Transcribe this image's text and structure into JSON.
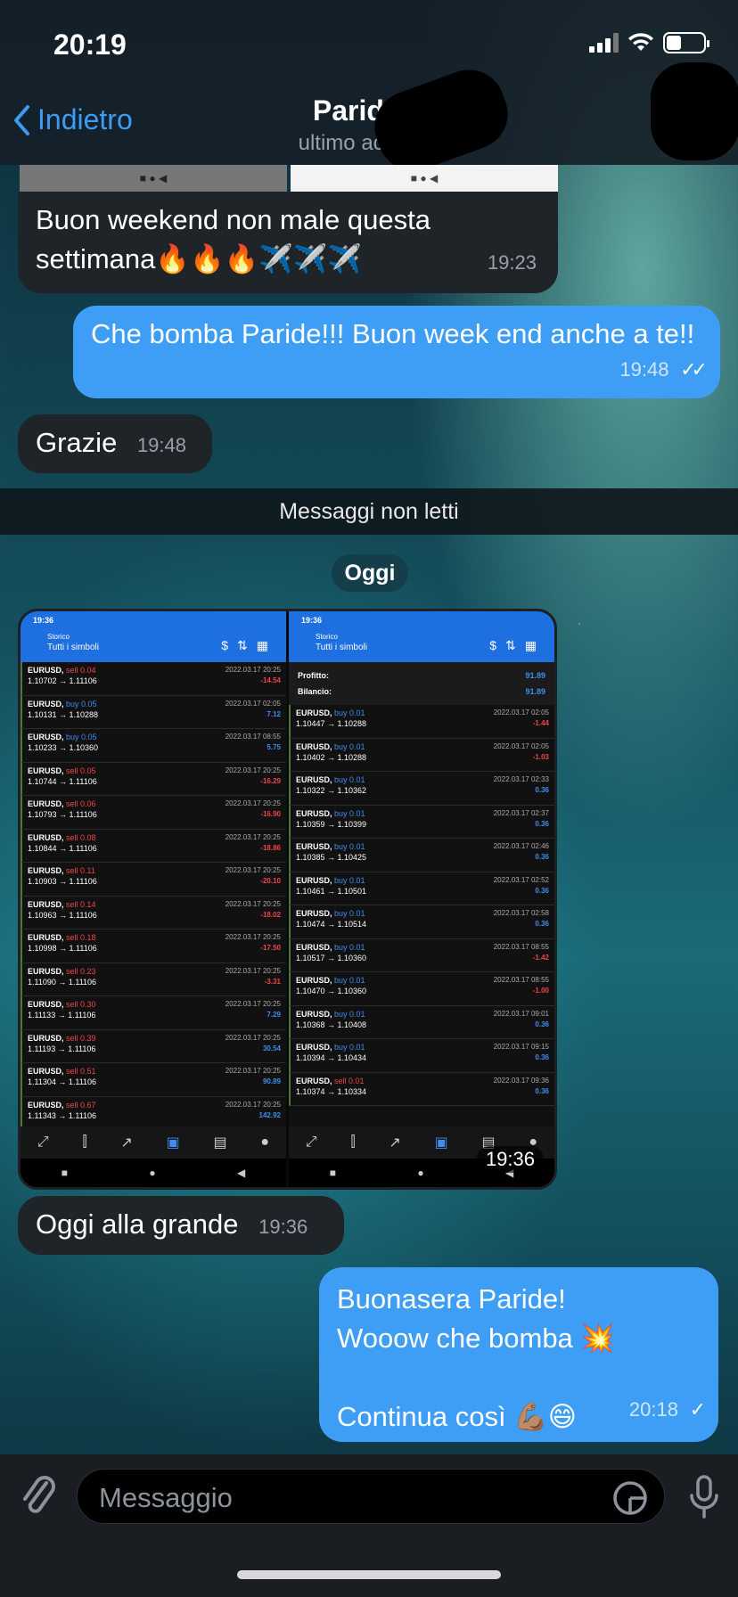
{
  "status_bar": {
    "time": "20:19"
  },
  "header": {
    "back_label": "Indietro",
    "contact_name": "Paride T",
    "contact_status": "ultimo accesso"
  },
  "messages": [
    {
      "dir": "in",
      "text": "Buon weekend non male questa settimana🔥🔥🔥✈️✈️✈️",
      "time": "19:23"
    },
    {
      "dir": "out",
      "text": "Che bomba Paride!!! Buon week end anche a te!!",
      "time": "19:48"
    },
    {
      "dir": "in",
      "text": "Grazie",
      "time": "19:48"
    },
    {
      "dir": "in",
      "text": "Oggi alla grande",
      "time": "19:36"
    },
    {
      "dir": "out",
      "line1": "Buonasera Paride!",
      "line2": "Wooow che bomba 💥",
      "line3": "Continua così 💪🏽😄",
      "time": "20:18"
    }
  ],
  "unread_label": "Messaggi non letti",
  "date_label": "Oggi",
  "screenshot": {
    "time": "19:36",
    "phone_time": "19:36",
    "app_title": "Storico",
    "app_subtitle": "Tutti i simboli",
    "summary": {
      "profit_label": "Profitto:",
      "profit": "91.89",
      "balance_label": "Bilancio:",
      "balance": "91.89"
    },
    "left_trades": [
      {
        "sym": "EURUSD,",
        "side": "sell 0.04",
        "type": "sell",
        "range": "1.10702 → 1.11106",
        "date": "2022.03.17 20:25",
        "pl": "-14.54",
        "pl_type": "neg"
      },
      {
        "sym": "EURUSD,",
        "side": "buy 0.05",
        "type": "buy",
        "range": "1.10131 → 1.10288",
        "date": "2022.03.17 02:05",
        "pl": "7.12",
        "pl_type": "pos"
      },
      {
        "sym": "EURUSD,",
        "side": "buy 0.05",
        "type": "buy",
        "range": "1.10233 → 1.10360",
        "date": "2022.03.17 08:55",
        "pl": "5.75",
        "pl_type": "pos"
      },
      {
        "sym": "EURUSD,",
        "side": "sell 0.05",
        "type": "sell",
        "range": "1.10744 → 1.11106",
        "date": "2022.03.17 20:25",
        "pl": "-16.29",
        "pl_type": "neg"
      },
      {
        "sym": "EURUSD,",
        "side": "sell 0.06",
        "type": "sell",
        "range": "1.10793 → 1.11106",
        "date": "2022.03.17 20:25",
        "pl": "-16.90",
        "pl_type": "neg"
      },
      {
        "sym": "EURUSD,",
        "side": "sell 0.08",
        "type": "sell",
        "range": "1.10844 → 1.11106",
        "date": "2022.03.17 20:25",
        "pl": "-18.86",
        "pl_type": "neg"
      },
      {
        "sym": "EURUSD,",
        "side": "sell 0.11",
        "type": "sell",
        "range": "1.10903 → 1.11106",
        "date": "2022.03.17 20:25",
        "pl": "-20.10",
        "pl_type": "neg"
      },
      {
        "sym": "EURUSD,",
        "side": "sell 0.14",
        "type": "sell",
        "range": "1.10963 → 1.11106",
        "date": "2022.03.17 20:25",
        "pl": "-18.02",
        "pl_type": "neg"
      },
      {
        "sym": "EURUSD,",
        "side": "sell 0.18",
        "type": "sell",
        "range": "1.10998 → 1.11106",
        "date": "2022.03.17 20:25",
        "pl": "-17.50",
        "pl_type": "neg"
      },
      {
        "sym": "EURUSD,",
        "side": "sell 0.23",
        "type": "sell",
        "range": "1.11090 → 1.11106",
        "date": "2022.03.17 20:25",
        "pl": "-3.31",
        "pl_type": "neg"
      },
      {
        "sym": "EURUSD,",
        "side": "sell 0.30",
        "type": "sell",
        "range": "1.11133 → 1.11106",
        "date": "2022.03.17 20:25",
        "pl": "7.29",
        "pl_type": "pos"
      },
      {
        "sym": "EURUSD,",
        "side": "sell 0.39",
        "type": "sell",
        "range": "1.11193 → 1.11106",
        "date": "2022.03.17 20:25",
        "pl": "30.54",
        "pl_type": "pos"
      },
      {
        "sym": "EURUSD,",
        "side": "sell 0.51",
        "type": "sell",
        "range": "1.11304 → 1.11106",
        "date": "2022.03.17 20:25",
        "pl": "90.89",
        "pl_type": "pos"
      },
      {
        "sym": "EURUSD,",
        "side": "sell 0.67",
        "type": "sell",
        "range": "1.11343 → 1.11106",
        "date": "2022.03.17 20:25",
        "pl": "142.92",
        "pl_type": "pos"
      }
    ],
    "right_trades": [
      {
        "sym": "EURUSD,",
        "side": "buy 0.01",
        "type": "buy",
        "range": "1.10447 → 1.10288",
        "date": "2022.03.17 02:05",
        "pl": "-1.44",
        "pl_type": "neg"
      },
      {
        "sym": "EURUSD,",
        "side": "buy 0.01",
        "type": "buy",
        "range": "1.10402 → 1.10288",
        "date": "2022.03.17 02:05",
        "pl": "-1.03",
        "pl_type": "neg"
      },
      {
        "sym": "EURUSD,",
        "side": "buy 0.01",
        "type": "buy",
        "range": "1.10322 → 1.10362",
        "date": "2022.03.17 02:33",
        "pl": "0.36",
        "pl_type": "pos"
      },
      {
        "sym": "EURUSD,",
        "side": "buy 0.01",
        "type": "buy",
        "range": "1.10359 → 1.10399",
        "date": "2022.03.17 02:37",
        "pl": "0.36",
        "pl_type": "pos"
      },
      {
        "sym": "EURUSD,",
        "side": "buy 0.01",
        "type": "buy",
        "range": "1.10385 → 1.10425",
        "date": "2022.03.17 02:46",
        "pl": "0.36",
        "pl_type": "pos"
      },
      {
        "sym": "EURUSD,",
        "side": "buy 0.01",
        "type": "buy",
        "range": "1.10461 → 1.10501",
        "date": "2022.03.17 02:52",
        "pl": "0.36",
        "pl_type": "pos"
      },
      {
        "sym": "EURUSD,",
        "side": "buy 0.01",
        "type": "buy",
        "range": "1.10474 → 1.10514",
        "date": "2022.03.17 02:58",
        "pl": "0.36",
        "pl_type": "pos"
      },
      {
        "sym": "EURUSD,",
        "side": "buy 0.01",
        "type": "buy",
        "range": "1.10517 → 1.10360",
        "date": "2022.03.17 08:55",
        "pl": "-1.42",
        "pl_type": "neg"
      },
      {
        "sym": "EURUSD,",
        "side": "buy 0.01",
        "type": "buy",
        "range": "1.10470 → 1.10360",
        "date": "2022.03.17 08:55",
        "pl": "-1.00",
        "pl_type": "neg"
      },
      {
        "sym": "EURUSD,",
        "side": "buy 0.01",
        "type": "buy",
        "range": "1.10368 → 1.10408",
        "date": "2022.03.17 09:01",
        "pl": "0.36",
        "pl_type": "pos"
      },
      {
        "sym": "EURUSD,",
        "side": "buy 0.01",
        "type": "buy",
        "range": "1.10394 → 1.10434",
        "date": "2022.03.17 09:15",
        "pl": "0.36",
        "pl_type": "pos"
      },
      {
        "sym": "EURUSD,",
        "side": "sell 0.01",
        "type": "sell",
        "range": "1.10374 → 1.10334",
        "date": "2022.03.17 09:36",
        "pl": "0.36",
        "pl_type": "pos"
      }
    ]
  },
  "input": {
    "placeholder": "Messaggio"
  },
  "icons": [
    "chevron-left-icon",
    "paperclip-icon",
    "sticker-icon",
    "microphone-icon"
  ],
  "colors": {
    "accent": "#3e9ef6",
    "incoming_bubble": "#1f2429",
    "sell": "#f04545",
    "buy": "#3e8cf0"
  }
}
